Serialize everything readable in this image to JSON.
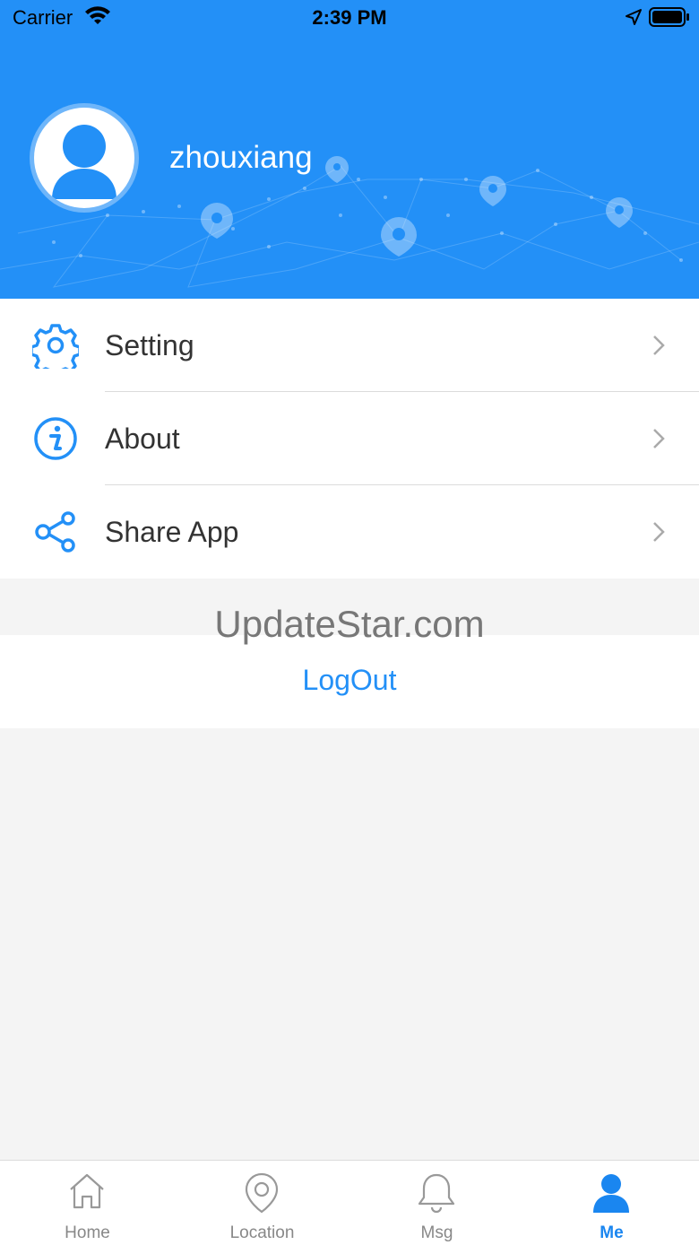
{
  "status_bar": {
    "carrier": "Carrier",
    "time": "2:39 PM"
  },
  "profile": {
    "username": "zhouxiang"
  },
  "menu": {
    "items": [
      {
        "label": "Setting",
        "icon": "gear-icon"
      },
      {
        "label": "About",
        "icon": "info-icon"
      },
      {
        "label": "Share App",
        "icon": "share-icon"
      }
    ]
  },
  "watermark": "UpdateStar.com",
  "logout_label": "LogOut",
  "tabbar": {
    "items": [
      {
        "label": "Home",
        "icon": "home-icon"
      },
      {
        "label": "Location",
        "icon": "location-pin-icon"
      },
      {
        "label": "Msg",
        "icon": "bell-icon"
      },
      {
        "label": "Me",
        "icon": "person-icon",
        "active": true
      }
    ]
  },
  "colors": {
    "accent": "#2390f7",
    "background": "#f4f4f4",
    "text": "#333333",
    "inactive_tab": "#888888"
  }
}
